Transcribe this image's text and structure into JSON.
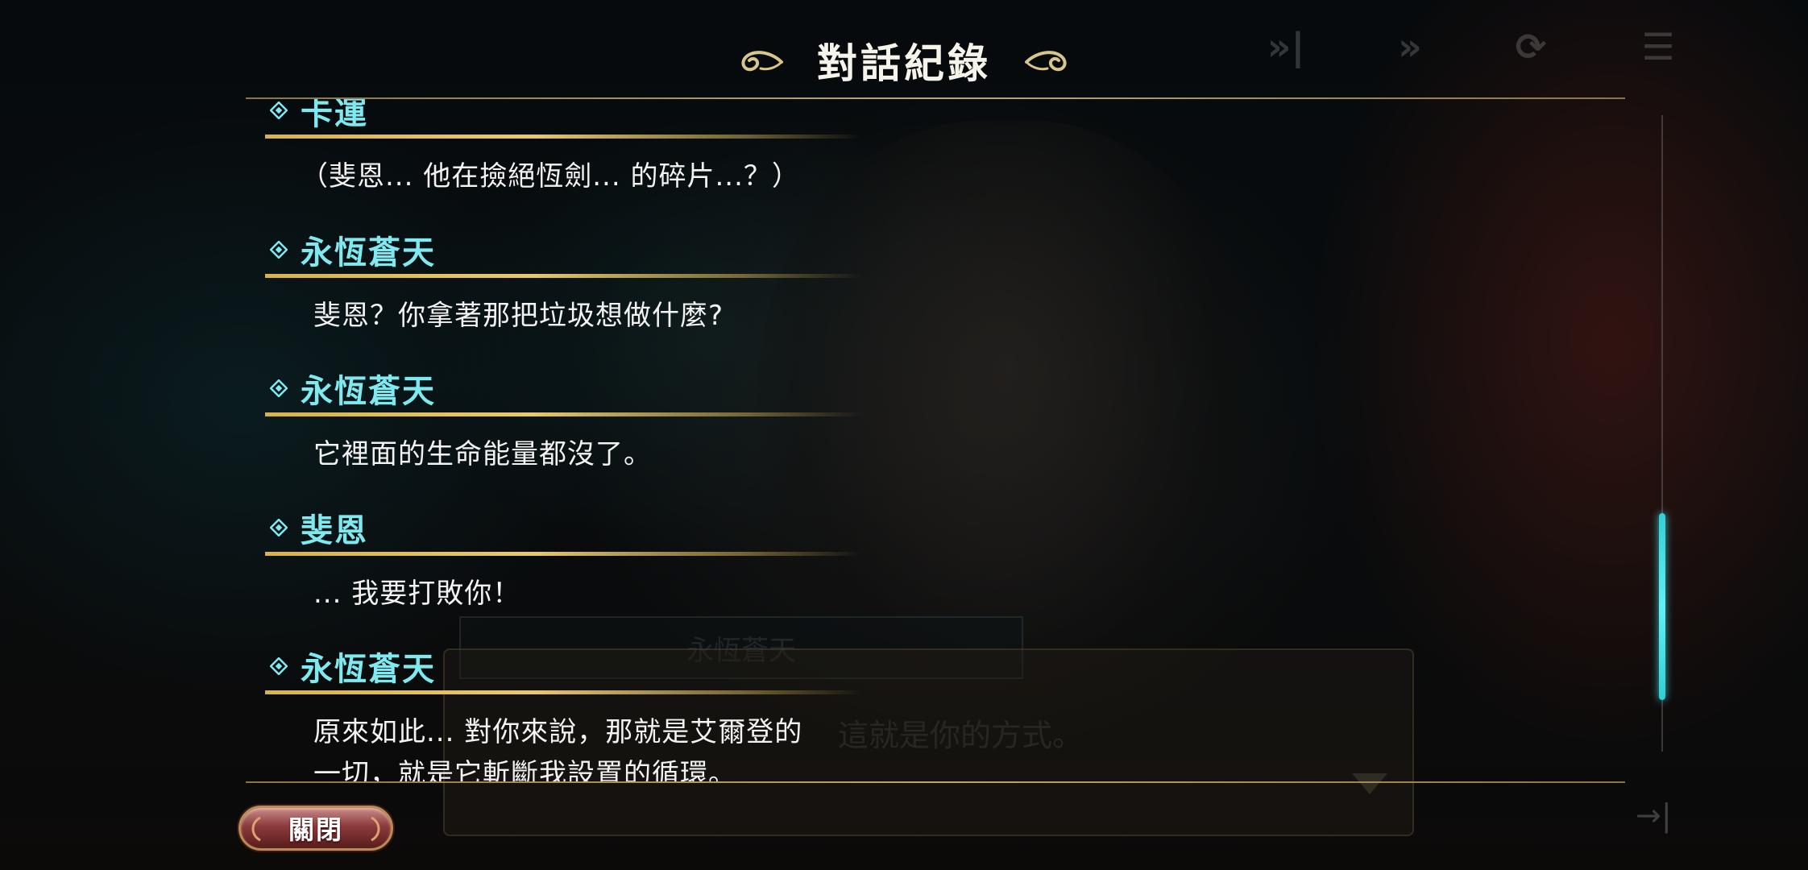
{
  "header": {
    "title": "對話紀錄"
  },
  "toolbar": {
    "icons": [
      "skip-forward-icon",
      "fast-forward-icon",
      "auto-play-icon",
      "log-icon"
    ],
    "skip_glyph": "»|",
    "ff_glyph": "»",
    "auto_glyph": "⟳",
    "log_glyph": "☰",
    "skip_end_glyph": "→|"
  },
  "log": {
    "entries": [
      {
        "speaker": "卡運",
        "lines": [
          "（斐恩... 他在撿絕恆劍... 的碎片...？）"
        ]
      },
      {
        "speaker": "永恆蒼天",
        "lines": [
          "斐恩？你拿著那把垃圾想做什麼?"
        ]
      },
      {
        "speaker": "永恆蒼天",
        "lines": [
          "它裡面的生命能量都沒了。"
        ]
      },
      {
        "speaker": "斐恩",
        "lines": [
          "... 我要打敗你！"
        ]
      },
      {
        "speaker": "永恆蒼天",
        "lines": [
          "原來如此... 對你來說，那就是艾爾登的",
          "一切，就是它斬斷我設置的循環。"
        ]
      }
    ]
  },
  "scroll": {
    "position_fraction": 0.72
  },
  "close_button": {
    "label": "關閉"
  },
  "background_scene": {
    "speaker_name": "永恆蒼天",
    "dialog_text": "這就是你的方式。"
  },
  "colors": {
    "speaker_name": "#7fe9f0",
    "underline": "#d9b24a",
    "scroll_thumb": "#5ff0f4",
    "close_button": "#8c3b3b"
  }
}
